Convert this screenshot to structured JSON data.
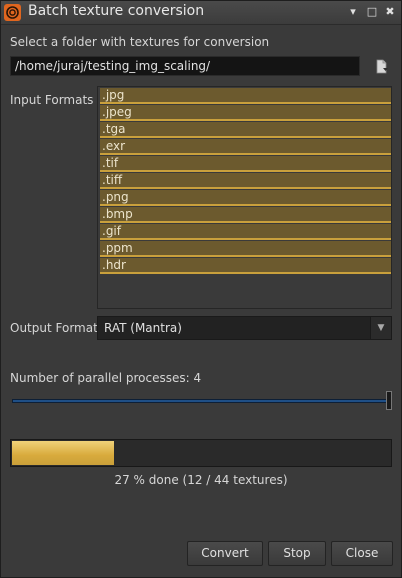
{
  "window": {
    "title": "Batch texture conversion",
    "controls": {
      "minimize": "▾",
      "maximize": "□",
      "close": "✖"
    }
  },
  "folder": {
    "prompt": "Select a folder with textures for conversion",
    "path": "/home/juraj/testing_img_scaling/",
    "browse_icon": "file-browse-icon"
  },
  "input_formats": {
    "label": "Input Formats",
    "items": [
      ".jpg",
      ".jpeg",
      ".tga",
      ".exr",
      ".tif",
      ".tiff",
      ".png",
      ".bmp",
      ".gif",
      ".ppm",
      ".hdr"
    ],
    "selected_all": true
  },
  "output_format": {
    "label": "Output Format",
    "value": "RAT (Mantra)"
  },
  "parallel": {
    "label": "Number of parallel processes: 4",
    "value": 4,
    "max_fraction": 1.0
  },
  "progress": {
    "fraction": 0.27,
    "status": "27 % done (12 / 44 textures)"
  },
  "buttons": {
    "convert": "Convert",
    "stop": "Stop",
    "close": "Close"
  },
  "colors": {
    "background": "#3a3a3a",
    "selection": "#6c5a2e",
    "selection_border": "#c9a03c",
    "progress_fill": "#d8aa3c",
    "slider": "#1f4f86",
    "app_icon": "#e0661f"
  }
}
